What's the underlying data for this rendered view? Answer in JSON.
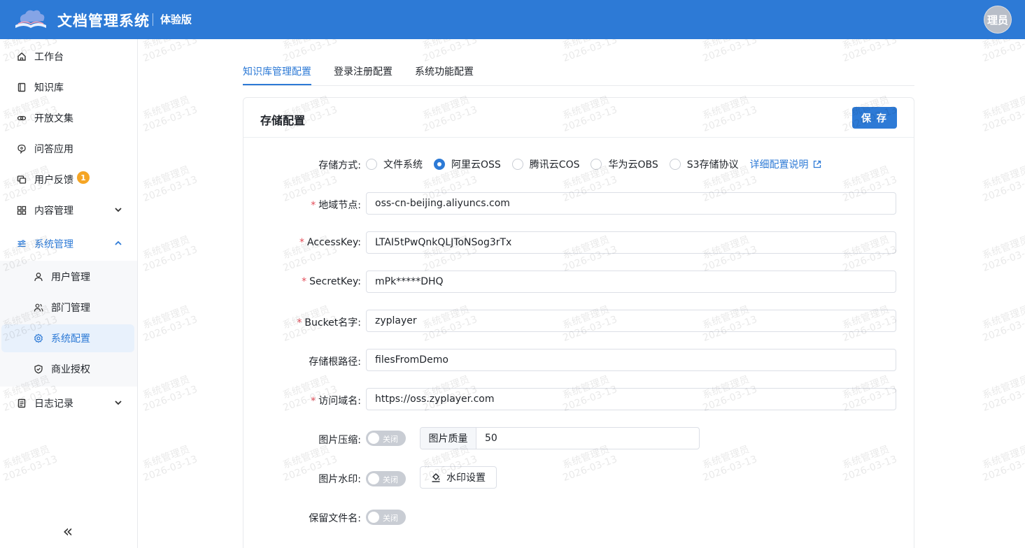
{
  "header": {
    "app_title": "文档管理系统",
    "edition": "体验版",
    "avatar_text": "理员",
    "bg_color": "#2d7ad6"
  },
  "sidebar": {
    "items": [
      {
        "label": "工作台",
        "icon": "home-icon"
      },
      {
        "label": "知识库",
        "icon": "book-icon"
      },
      {
        "label": "开放文集",
        "icon": "link-icon"
      },
      {
        "label": "问答应用",
        "icon": "chat-brain-icon"
      },
      {
        "label": "用户反馈",
        "icon": "feedback-icon",
        "badge": "1"
      },
      {
        "label": "内容管理",
        "icon": "grid-icon"
      },
      {
        "label": "系统管理",
        "icon": "sliders-icon"
      },
      {
        "label": "日志记录",
        "icon": "log-icon"
      }
    ],
    "sub_items": [
      {
        "label": "用户管理",
        "icon": "user-icon"
      },
      {
        "label": "部门管理",
        "icon": "users-icon"
      },
      {
        "label": "系统配置",
        "icon": "gear-icon"
      },
      {
        "label": "商业授权",
        "icon": "shield-icon"
      }
    ],
    "collapse_glyph": "«"
  },
  "tabs": [
    "知识库管理配置",
    "登录注册配置",
    "系统功能配置"
  ],
  "card": {
    "title": "存储配置",
    "save_label": "保 存"
  },
  "form": {
    "storage_label": "存储方式:",
    "storage_options": [
      "文件系统",
      "阿里云OSS",
      "腾讯云COS",
      "华为云OBS",
      "S3存储协议"
    ],
    "storage_selected": "阿里云OSS",
    "doc_link": "详细配置说明",
    "fields": [
      {
        "label": "地域节点:",
        "required": true,
        "value": "oss-cn-beijing.aliyuncs.com"
      },
      {
        "label": "AccessKey:",
        "required": true,
        "value": "LTAI5tPwQnkQLJToNSog3rTx"
      },
      {
        "label": "SecretKey:",
        "required": true,
        "value": "mPk*****DHQ"
      },
      {
        "label": "Bucket名字:",
        "required": true,
        "value": "zyplayer"
      },
      {
        "label": "存储根路径:",
        "required": false,
        "value": "filesFromDemo"
      },
      {
        "label": "访问域名:",
        "required": true,
        "value": "https://oss.zyplayer.com"
      }
    ],
    "compress_label": "图片压缩:",
    "compress_state": "关闭",
    "quality_label": "图片质量",
    "quality_value": "50",
    "watermark_label": "图片水印:",
    "watermark_state": "关闭",
    "watermark_button": "水印设置",
    "keep_name_label": "保留文件名:",
    "keep_name_state": "关闭"
  },
  "watermark": {
    "line1": "系统管理员",
    "line2": "2026-03-13"
  }
}
